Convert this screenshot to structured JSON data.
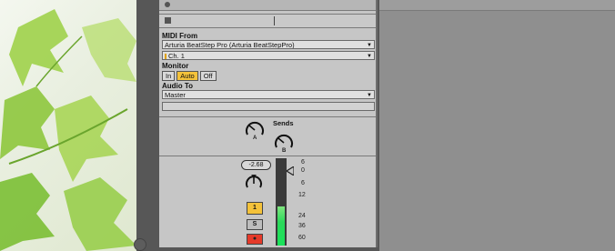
{
  "track": {
    "midi_from_label": "MIDI From",
    "midi_from_value": "Arturia BeatStep Pro (Arturia BeatStepPro)",
    "channel_value": "Ch. 1",
    "monitor_label": "Monitor",
    "monitor_options": [
      "In",
      "Auto",
      "Off"
    ],
    "monitor_selected": "Auto",
    "audio_to_label": "Audio To",
    "audio_to_value": "Master",
    "sends_label": "Sends",
    "send_a_letter": "A",
    "send_b_letter": "B"
  },
  "mixer": {
    "volume_value": "-2.68",
    "meter_scale": [
      "6",
      "0",
      "6",
      "12",
      "24",
      "36",
      "60"
    ],
    "track_number": "1",
    "solo_label": "S",
    "arm_icon": "record-arm-icon",
    "meter_left_level": 0.45,
    "meter_right_level": 0.45
  },
  "colors": {
    "monitor_active": "#f4c23a",
    "track_number_bg": "#f4c23a",
    "arm_bg": "#e53a2a",
    "meter_green": "#19e35a",
    "panel_bg": "#c6c6c6"
  }
}
